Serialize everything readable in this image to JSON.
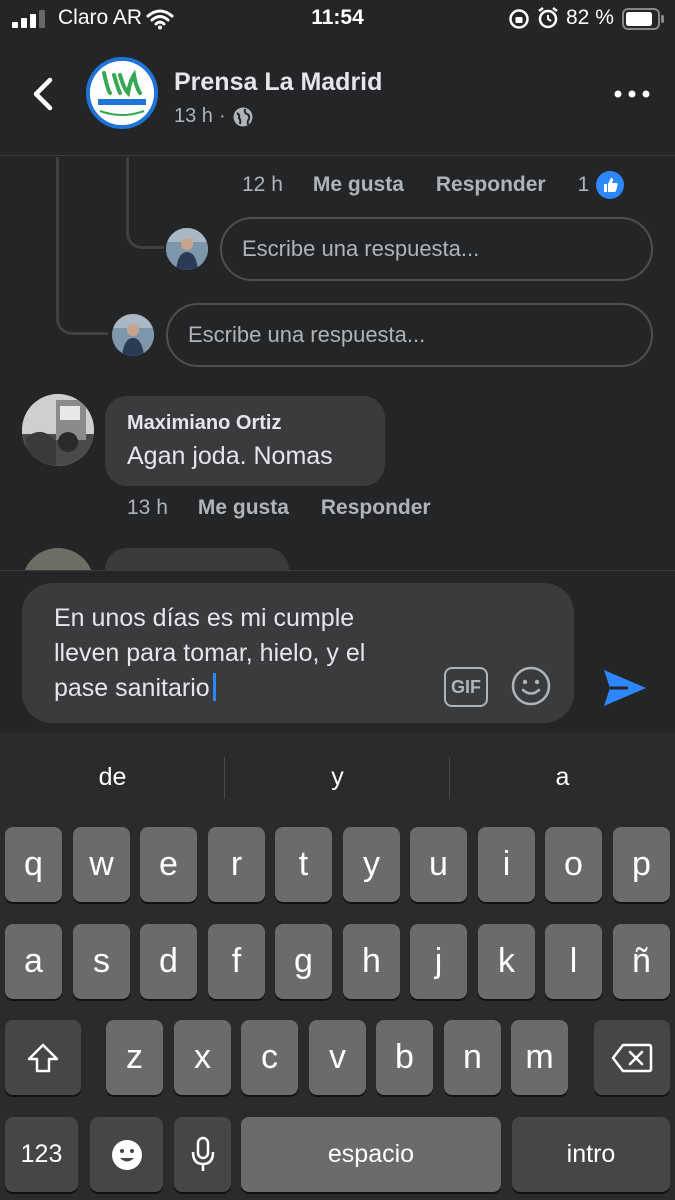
{
  "status_bar": {
    "carrier": "Claro AR",
    "time": "11:54",
    "battery": "82 %"
  },
  "header": {
    "title": "Prensa La Madrid",
    "time": "13 h",
    "separator": "·"
  },
  "thread": {
    "reply_row": {
      "time": "12 h",
      "like": "Me gusta",
      "reply": "Responder",
      "reaction_count": "1"
    },
    "nested_reply_placeholder": "Escribe una respuesta...",
    "reply_placeholder": "Escribe una respuesta...",
    "comment": {
      "author": "Maximiano Ortiz",
      "text": "Agan joda. Nomas",
      "time": "13 h",
      "like": "Me gusta",
      "reply": "Responder"
    }
  },
  "composer": {
    "line1": "En unos días es mi cumple",
    "line2": "lleven para tomar, hielo, y el",
    "line3": "pase sanitario",
    "gif_label": "GIF"
  },
  "keyboard": {
    "suggestions": [
      "de",
      "y",
      "a"
    ],
    "row1": [
      "q",
      "w",
      "e",
      "r",
      "t",
      "y",
      "u",
      "i",
      "o",
      "p"
    ],
    "row2": [
      "a",
      "s",
      "d",
      "f",
      "g",
      "h",
      "j",
      "k",
      "l",
      "ñ"
    ],
    "row3": [
      "z",
      "x",
      "c",
      "v",
      "b",
      "n",
      "m"
    ],
    "numbers_label": "123",
    "space_label": "espacio",
    "return_label": "intro"
  },
  "icons": {
    "back": "chevron-left-icon",
    "more": "more-horizontal-icon",
    "public": "globe-icon",
    "like": "thumbs-up-icon",
    "send": "send-icon",
    "emoji": "emoji-icon",
    "shift": "shift-icon",
    "delete": "backspace-icon",
    "mic": "microphone-icon"
  },
  "colors": {
    "accent": "#2d88ff",
    "background": "#242526",
    "bubble": "#3a3b3c"
  }
}
